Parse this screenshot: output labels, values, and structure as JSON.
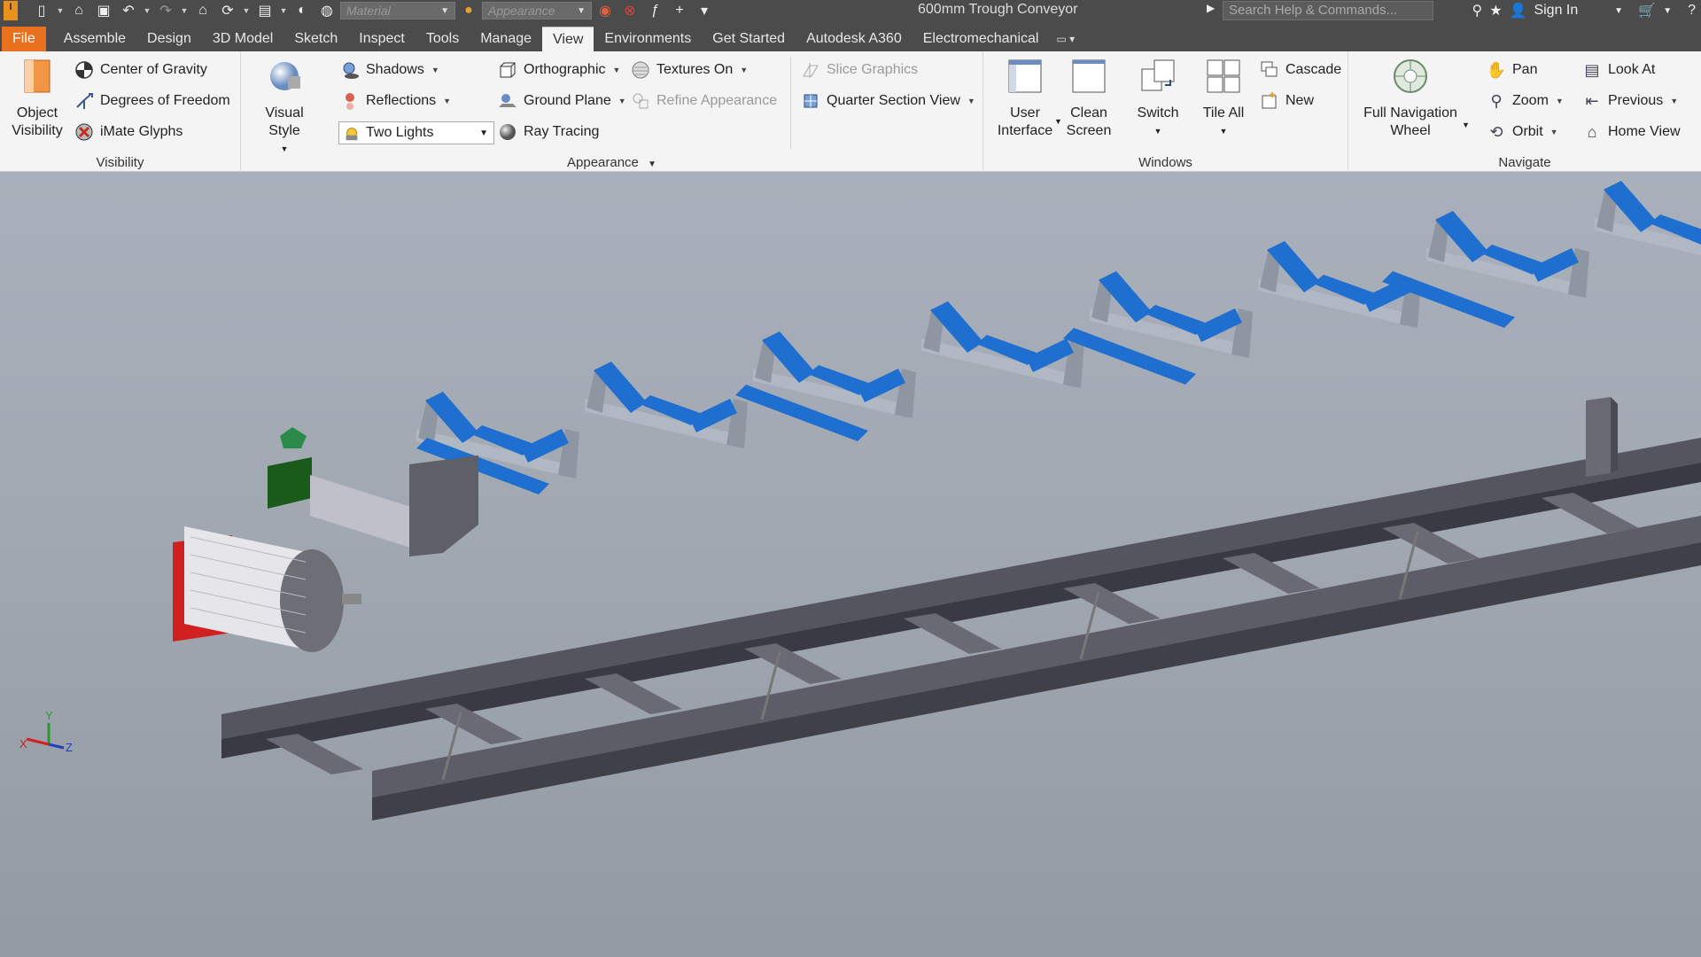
{
  "titlebar": {
    "app_logo": "I",
    "doc_title": "600mm Trough Conveyor",
    "material_placeholder": "Material",
    "appearance_placeholder": "Appearance",
    "search_placeholder": "Search Help & Commands...",
    "sign_in": "Sign In"
  },
  "tabs": [
    "File",
    "Assemble",
    "Design",
    "3D Model",
    "Sketch",
    "Inspect",
    "Tools",
    "Manage",
    "View",
    "Environments",
    "Get Started",
    "Autodesk A360",
    "Electromechanical"
  ],
  "active_tab": "View",
  "ribbon": {
    "visibility": {
      "label": "Visibility",
      "object_visibility_1": "Object",
      "object_visibility_2": "Visibility",
      "center_of_gravity": "Center of Gravity",
      "degrees_of_freedom": "Degrees of Freedom",
      "imate_glyphs": "iMate Glyphs"
    },
    "appearance": {
      "label": "Appearance",
      "visual_style": "Visual Style",
      "shadows": "Shadows",
      "reflections": "Reflections",
      "lighting": "Two Lights",
      "orthographic": "Orthographic",
      "ground_plane": "Ground Plane",
      "ray_tracing": "Ray Tracing",
      "textures_on": "Textures On",
      "refine_appearance": "Refine Appearance",
      "slice_graphics": "Slice Graphics",
      "quarter_section": "Quarter Section View"
    },
    "windows": {
      "label": "Windows",
      "user_interface_1": "User",
      "user_interface_2": "Interface",
      "clean_screen_1": "Clean",
      "clean_screen_2": "Screen",
      "switch": "Switch",
      "tile_all": "Tile All",
      "cascade": "Cascade",
      "new": "New"
    },
    "navigate": {
      "label": "Navigate",
      "full_nav_1": "Full Navigation",
      "full_nav_2": "Wheel",
      "pan": "Pan",
      "zoom": "Zoom",
      "orbit": "Orbit",
      "look_at": "Look At",
      "previous": "Previous",
      "home_view": "Home View"
    }
  },
  "triad": {
    "x": "X",
    "y": "Y",
    "z": "Z"
  },
  "colors": {
    "roller": "#1f6fd0",
    "frame": "#6e6e78",
    "tab_file": "#e8701e"
  }
}
